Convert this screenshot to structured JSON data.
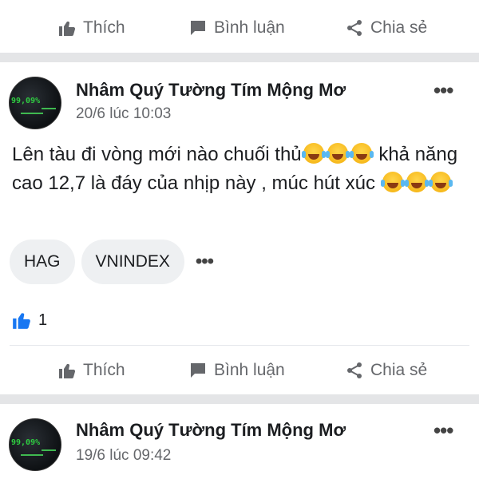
{
  "actions": {
    "like": "Thích",
    "comment": "Bình luận",
    "share": "Chia sẻ"
  },
  "posts": [
    {
      "author": "Nhâm Quý Tường Tím Mộng Mơ",
      "timestamp": "20/6 lúc 10:03",
      "avatar_text": "99,09%",
      "text_part1": "Lên tàu đi vòng mới nào chuối thủ",
      "text_part2": " khả năng cao 12,7 là đáy của nhịp này , múc hút xúc ",
      "tags": [
        "HAG",
        "VNINDEX"
      ],
      "like_count": "1"
    },
    {
      "author": "Nhâm Quý Tường Tím Mộng Mơ",
      "timestamp": "19/6 lúc 09:42",
      "avatar_text": "99,09%"
    }
  ],
  "colors": {
    "muted": "#65676b",
    "like_blue": "#1877f2",
    "divider": "#e4e5e7"
  },
  "icons": [
    "thumbs-up-icon",
    "comment-icon",
    "share-icon",
    "more-icon",
    "laughing-emoji-icon"
  ]
}
